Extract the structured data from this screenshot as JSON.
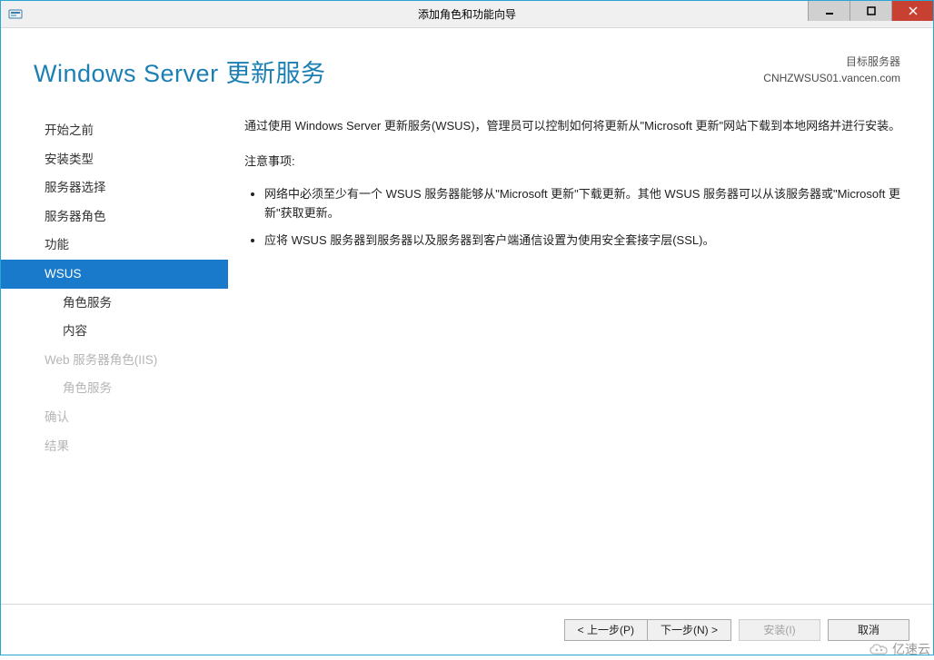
{
  "window": {
    "title": "添加角色和功能向导"
  },
  "header": {
    "page_title": "Windows Server 更新服务",
    "target_label": "目标服务器",
    "target_server": "CNHZWSUS01.vancen.com"
  },
  "sidebar": {
    "items": [
      {
        "label": "开始之前",
        "selected": false,
        "disabled": false,
        "sub": false
      },
      {
        "label": "安装类型",
        "selected": false,
        "disabled": false,
        "sub": false
      },
      {
        "label": "服务器选择",
        "selected": false,
        "disabled": false,
        "sub": false
      },
      {
        "label": "服务器角色",
        "selected": false,
        "disabled": false,
        "sub": false
      },
      {
        "label": "功能",
        "selected": false,
        "disabled": false,
        "sub": false
      },
      {
        "label": "WSUS",
        "selected": true,
        "disabled": false,
        "sub": false
      },
      {
        "label": "角色服务",
        "selected": false,
        "disabled": false,
        "sub": true
      },
      {
        "label": "内容",
        "selected": false,
        "disabled": false,
        "sub": true
      },
      {
        "label": "Web 服务器角色(IIS)",
        "selected": false,
        "disabled": true,
        "sub": false
      },
      {
        "label": "角色服务",
        "selected": false,
        "disabled": true,
        "sub": true
      },
      {
        "label": "确认",
        "selected": false,
        "disabled": true,
        "sub": false
      },
      {
        "label": "结果",
        "selected": false,
        "disabled": true,
        "sub": false
      }
    ]
  },
  "content": {
    "intro": "通过使用 Windows Server 更新服务(WSUS)，管理员可以控制如何将更新从\"Microsoft 更新\"网站下载到本地网络并进行安装。",
    "notes_heading": "注意事项:",
    "notes": [
      "网络中必须至少有一个 WSUS 服务器能够从\"Microsoft 更新\"下载更新。其他 WSUS 服务器可以从该服务器或\"Microsoft 更新\"获取更新。",
      "应将 WSUS 服务器到服务器以及服务器到客户端通信设置为使用安全套接字层(SSL)。"
    ]
  },
  "footer": {
    "prev": "< 上一步(P)",
    "next": "下一步(N) >",
    "install": "安装(I)",
    "cancel": "取消"
  },
  "watermark": "亿速云"
}
